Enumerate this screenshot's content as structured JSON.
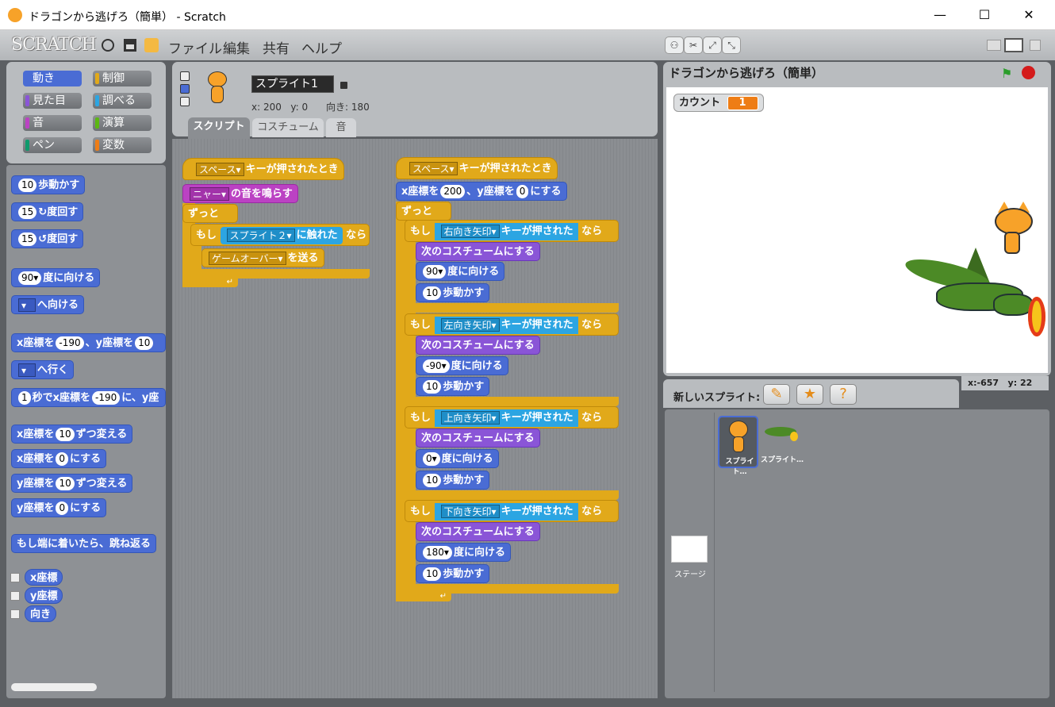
{
  "window": {
    "title": "ドラゴンから逃げろ（簡単） - Scratch",
    "minimize": "—",
    "maximize": "☐",
    "close": "✕"
  },
  "app": {
    "logo": "SCRATCH",
    "menu": [
      "ファイル",
      "編集",
      "共有",
      "ヘルプ"
    ]
  },
  "categories": [
    {
      "label": "動き",
      "color": "#4a6cd4"
    },
    {
      "label": "制御",
      "color": "#e1a91a"
    },
    {
      "label": "見た目",
      "color": "#8a55d7"
    },
    {
      "label": "調べる",
      "color": "#2ca5e2"
    },
    {
      "label": "音",
      "color": "#bb42c3"
    },
    {
      "label": "演算",
      "color": "#5cb712"
    },
    {
      "label": "ペン",
      "color": "#0e9a6c"
    },
    {
      "label": "変数",
      "color": "#ee7d16"
    }
  ],
  "palette": {
    "move_steps": {
      "value": "10",
      "text": "歩動かす"
    },
    "turn_right": {
      "value": "15",
      "icon": "↻",
      "text": "度回す"
    },
    "turn_left": {
      "value": "15",
      "icon": "↺",
      "text": "度回す"
    },
    "point_dir": {
      "value": "90▾",
      "text": "度に向ける"
    },
    "point_towards": {
      "text": "へ向ける"
    },
    "goto_xy": {
      "a": "x座標を",
      "x": "-190",
      "b": "、y座標を",
      "y": "10"
    },
    "goto": {
      "text": "へ行く"
    },
    "glide": {
      "a": "1",
      "b": "秒でx座標を",
      "x": "-190",
      "c": "に、y座"
    },
    "change_x": {
      "a": "x座標を",
      "v": "10",
      "b": "ずつ変える"
    },
    "set_x": {
      "a": "x座標を",
      "v": "0",
      "b": "にする"
    },
    "change_y": {
      "a": "y座標を",
      "v": "10",
      "b": "ずつ変える"
    },
    "set_y": {
      "a": "y座標を",
      "v": "0",
      "b": "にする"
    },
    "bounce": "もし端に着いたら、跳ね返る",
    "xpos": "x座標",
    "ypos": "y座標",
    "direction": "向き"
  },
  "sprite_info": {
    "name": "スプライト1",
    "x_label": "x:",
    "x": "200",
    "y_label": "y:",
    "y": "0",
    "dir_label": "向き:",
    "dir": "180"
  },
  "tabs": [
    "スクリプト",
    "コスチューム",
    "音"
  ],
  "script1": {
    "hat_key": "スペース▾",
    "hat_text": "キーが押されたとき",
    "sound": "ニャー▾",
    "sound_text": "の音を鳴らす",
    "forever": "ずっと",
    "if": "もし",
    "touch_sprite": "スプライト２▾",
    "touch_text": "に触れた",
    "then": "なら",
    "broadcast": "ゲームオーバー▾",
    "broadcast_text": "を送る"
  },
  "script2": {
    "hat_key": "スペース▾",
    "hat_text": "キーが押されたとき",
    "goto_a": "x座標を",
    "goto_x": "200",
    "goto_b": "、y座標を",
    "goto_y": "0",
    "goto_c": "にする",
    "forever": "ずっと",
    "if": "もし",
    "then": "なら",
    "key_pressed": "キーが押された",
    "next_costume": "次のコスチュームにする",
    "point_text": "度に向ける",
    "steps": "10",
    "steps_text": "歩動かす",
    "branches": [
      {
        "key": "右向き矢印▾",
        "dir": "90▾"
      },
      {
        "key": "左向き矢印▾",
        "dir": "-90▾"
      },
      {
        "key": "上向き矢印▾",
        "dir": "0▾"
      },
      {
        "key": "下向き矢印▾",
        "dir": "180▾"
      }
    ]
  },
  "stage": {
    "title": "ドラゴンから逃げろ（簡単）",
    "var_label": "カウント",
    "var_value": "1",
    "mouse_x_label": "x:",
    "mouse_x": "-657",
    "mouse_y_label": "y:",
    "mouse_y": "22"
  },
  "sprites": {
    "new_label": "新しいスプライト:",
    "items": [
      "スプライト…",
      "スプライト…"
    ],
    "stage_label": "ステージ"
  }
}
